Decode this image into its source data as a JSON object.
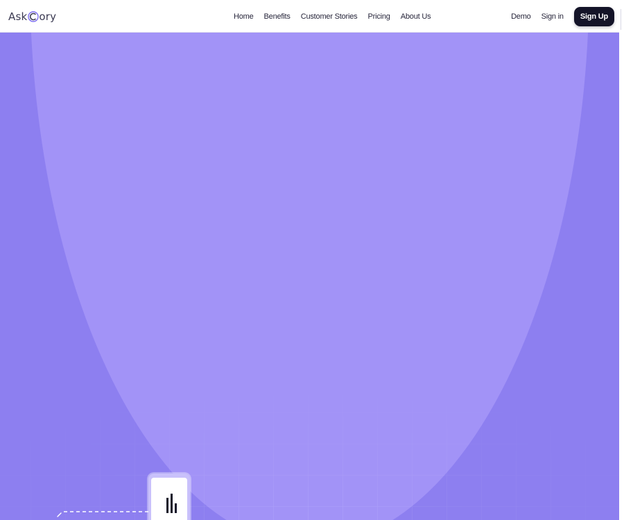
{
  "brand": {
    "name_part1": "Ask",
    "name_part2": "ory",
    "logo_icon": "ring-c-logo-mark"
  },
  "nav": {
    "items": [
      {
        "label": "Home"
      },
      {
        "label": "Benefits"
      },
      {
        "label": "Customer Stories"
      },
      {
        "label": "Pricing"
      },
      {
        "label": "About Us"
      }
    ]
  },
  "nav_right": {
    "demo_label": "Demo",
    "signin_label": "Sign in",
    "signup_label": "Sign Up"
  },
  "hero": {
    "icons": [
      "bar-chart-icon",
      "dashed-connector-line"
    ]
  },
  "colors": {
    "hero_bg": "#8d7ff0",
    "hero_arch": "#a293f7",
    "signup_bg": "#141428",
    "logo_ring": "#7b6cf0"
  }
}
